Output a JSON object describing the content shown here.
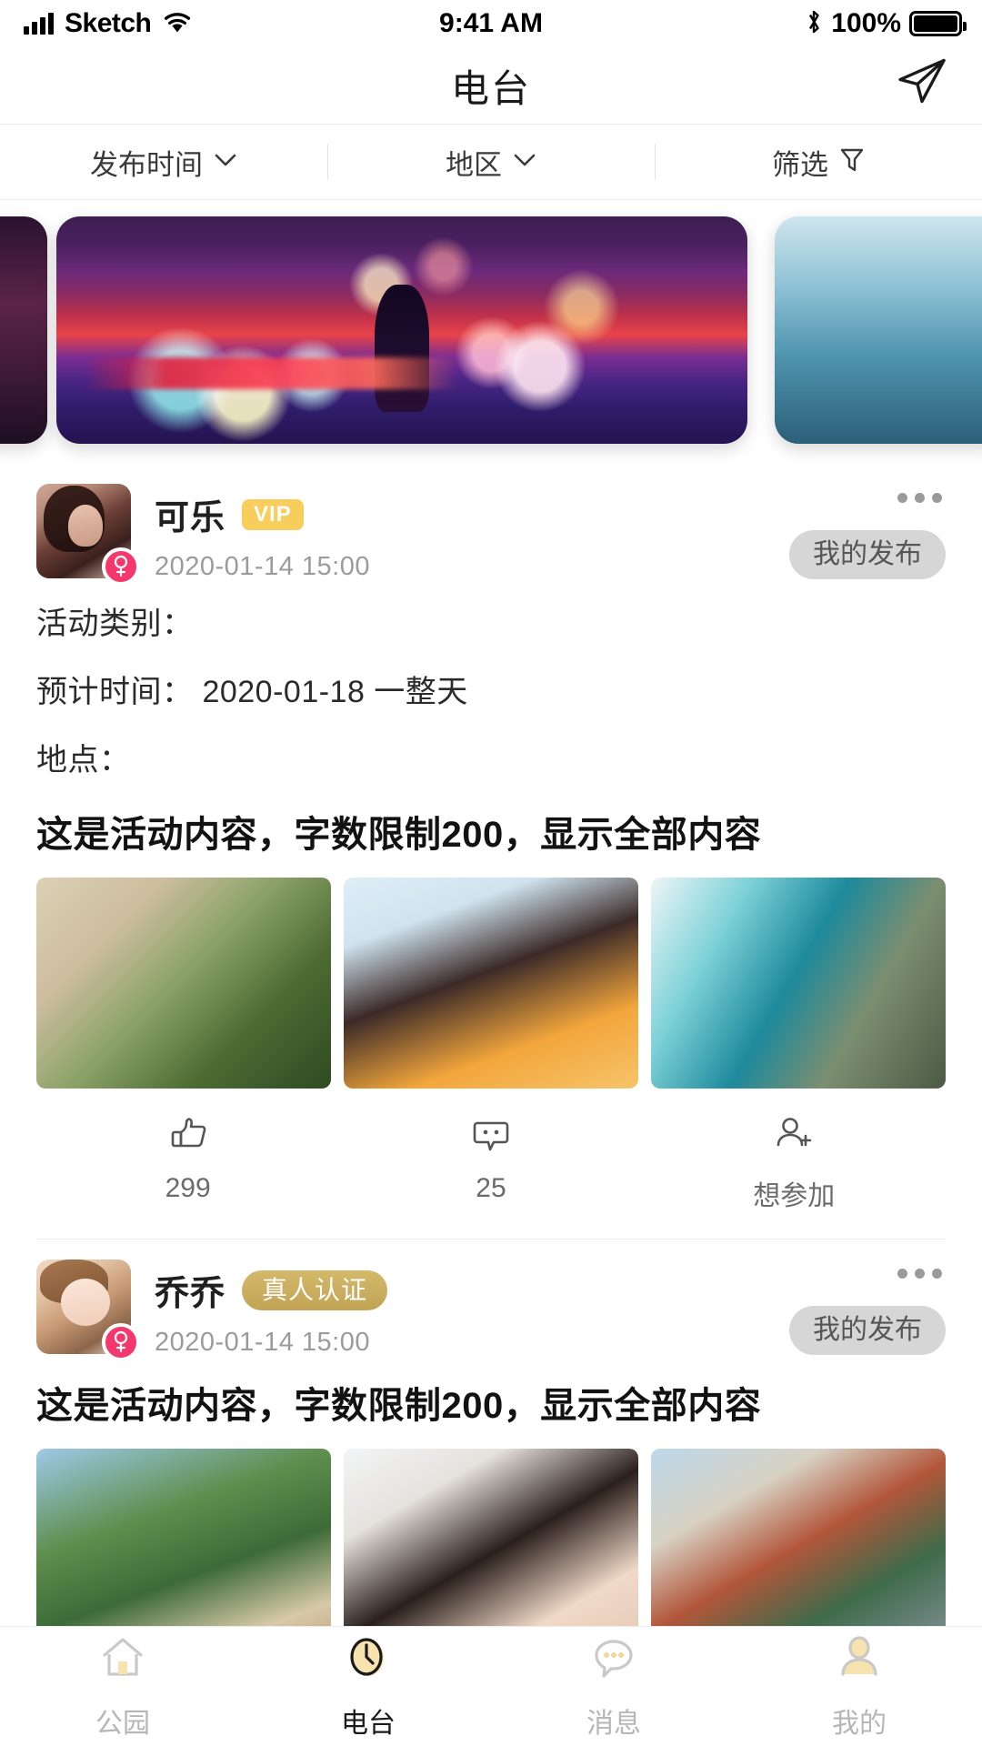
{
  "status_bar": {
    "carrier": "Sketch",
    "time": "9:41 AM",
    "battery_percent": "100%",
    "signal_icon": "signal-bars-icon",
    "wifi_icon": "wifi-icon",
    "bluetooth_icon": "bluetooth-icon",
    "battery_icon": "battery-full-icon"
  },
  "header": {
    "title": "电台",
    "send_icon": "send-paper-plane-icon"
  },
  "filters": [
    {
      "label": "发布时间",
      "icon": "chevron-down-icon"
    },
    {
      "label": "地区",
      "icon": "chevron-down-icon"
    },
    {
      "label": "筛选",
      "icon": "funnel-filter-icon"
    }
  ],
  "carousel": {
    "slides": [
      {
        "name": "banner-prev",
        "alt": "abstract-night-painting"
      },
      {
        "name": "banner-main",
        "alt": "neon-city-night-painting"
      },
      {
        "name": "banner-next",
        "alt": "coastal-blue-photo"
      }
    ]
  },
  "posts": [
    {
      "user": {
        "name": "可乐",
        "badge": "VIP",
        "badge_type": "vip",
        "gender_icon": "female-gender-icon",
        "avatar_alt": "woman-portrait-avatar"
      },
      "timestamp": "2020-01-14  15:00",
      "more_icon": "more-dots-icon",
      "owner_tag": "我的发布",
      "details": [
        "活动类别：",
        "预计时间： 2020-01-18 一整天",
        "地点："
      ],
      "title": "这是活动内容，字数限制200，显示全部内容",
      "thumbs": [
        {
          "name": "thumb-villa",
          "alt": "resort-building-palms"
        },
        {
          "name": "thumb-boy",
          "alt": "smiling-boy-yellow-jacket"
        },
        {
          "name": "thumb-coast",
          "alt": "aerial-coastal-road"
        }
      ],
      "actions": [
        {
          "icon": "thumbs-up-icon",
          "label": "299"
        },
        {
          "icon": "comment-bubble-icon",
          "label": "25"
        },
        {
          "icon": "person-add-icon",
          "label": "想参加"
        }
      ]
    },
    {
      "user": {
        "name": "乔乔",
        "badge": "真人认证",
        "badge_type": "real",
        "gender_icon": "female-gender-icon",
        "avatar_alt": "woman-portrait-avatar"
      },
      "timestamp": "2020-01-14  15:00",
      "more_icon": "more-dots-icon",
      "owner_tag": "我的发布",
      "details": [],
      "title": "这是活动内容，字数限制200，显示全部内容",
      "thumbs": [
        {
          "name": "thumb-lake",
          "alt": "lakeside-village-hills"
        },
        {
          "name": "thumb-face",
          "alt": "woman-closeup-portrait"
        },
        {
          "name": "thumb-city",
          "alt": "city-street-buildings"
        }
      ],
      "actions": []
    }
  ],
  "tabbar": {
    "items": [
      {
        "label": "公园",
        "icon": "home-icon",
        "active": false
      },
      {
        "label": "电台",
        "icon": "clock-icon",
        "active": true
      },
      {
        "label": "消息",
        "icon": "chat-bubble-icon",
        "active": false
      },
      {
        "label": "我的",
        "icon": "person-icon",
        "active": false
      }
    ]
  },
  "colors": {
    "accent_gold": "#f7cd5c",
    "verify_gold": "#c2a354",
    "gender_pink": "#f4376d",
    "tag_gray": "#d6d6d6",
    "text_primary": "#1a1a1a",
    "text_muted": "#9b9b9b",
    "tab_inactive": "#b6b6b6"
  }
}
